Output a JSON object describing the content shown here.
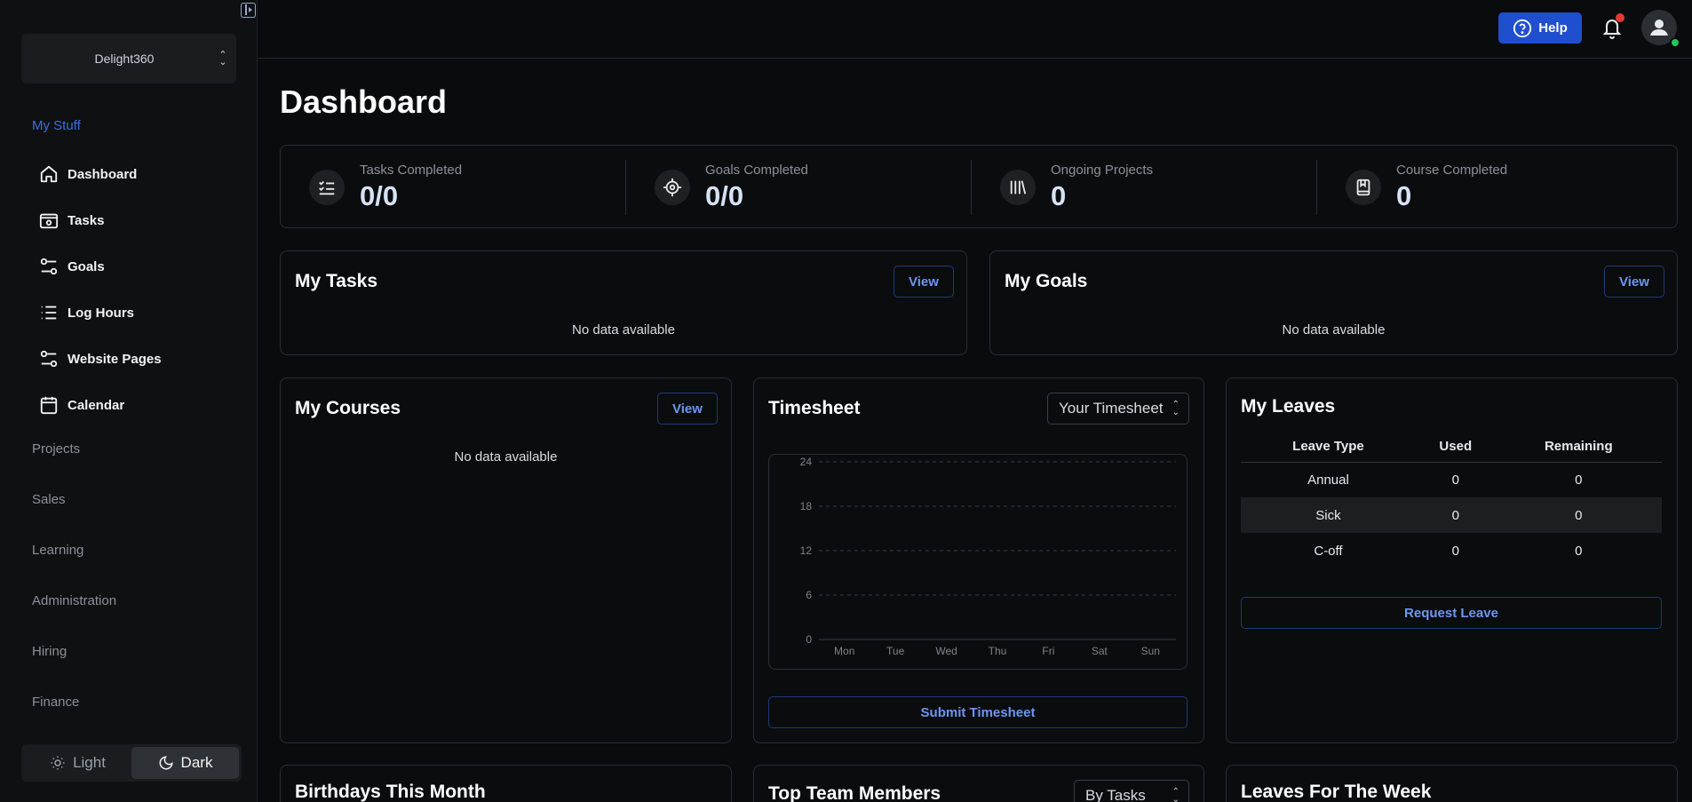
{
  "sidebar": {
    "org": "Delight360",
    "section_active": "My Stuff",
    "items": [
      {
        "label": "Dashboard",
        "icon": "home-icon"
      },
      {
        "label": "Tasks",
        "icon": "task-settings-icon"
      },
      {
        "label": "Goals",
        "icon": "sliders-icon"
      },
      {
        "label": "Log Hours",
        "icon": "list-icon"
      },
      {
        "label": "Website Pages",
        "icon": "sliders-icon"
      },
      {
        "label": "Calendar",
        "icon": "calendar-icon"
      }
    ],
    "sections": [
      "Projects",
      "Sales",
      "Learning",
      "Administration",
      "Hiring",
      "Finance"
    ],
    "theme": {
      "light": "Light",
      "dark": "Dark",
      "selected": "Dark"
    }
  },
  "header": {
    "help": "Help",
    "accent": "#1f4fcf"
  },
  "page": {
    "title": "Dashboard"
  },
  "stats": [
    {
      "label": "Tasks Completed",
      "value": "0/0",
      "icon": "checklist-icon"
    },
    {
      "label": "Goals Completed",
      "value": "0/0",
      "icon": "target-icon"
    },
    {
      "label": "Ongoing Projects",
      "value": "0",
      "icon": "library-icon"
    },
    {
      "label": "Course Completed",
      "value": "0",
      "icon": "book-bookmark-icon"
    }
  ],
  "my_tasks": {
    "title": "My Tasks",
    "view": "View",
    "empty": "No data available"
  },
  "my_goals": {
    "title": "My Goals",
    "view": "View",
    "empty": "No data available"
  },
  "my_courses": {
    "title": "My Courses",
    "view": "View",
    "empty": "No data available"
  },
  "timesheet": {
    "title": "Timesheet",
    "select": "Your Timesheet",
    "submit": "Submit Timesheet",
    "chart_data": {
      "type": "bar",
      "categories": [
        "Mon",
        "Tue",
        "Wed",
        "Thu",
        "Fri",
        "Sat",
        "Sun"
      ],
      "values": [
        0,
        0,
        0,
        0,
        0,
        0,
        0
      ],
      "yticks": [
        0,
        6,
        12,
        18,
        24
      ],
      "ylim": [
        0,
        24
      ],
      "grid": true
    }
  },
  "my_leaves": {
    "title": "My Leaves",
    "headers": [
      "Leave Type",
      "Used",
      "Remaining"
    ],
    "rows": [
      [
        "Annual",
        "0",
        "0"
      ],
      [
        "Sick",
        "0",
        "0"
      ],
      [
        "C-off",
        "0",
        "0"
      ]
    ],
    "request": "Request Leave"
  },
  "bottom": {
    "birthdays": "Birthdays This Month",
    "top_team": "Top Team Members",
    "top_team_select": "By Tasks",
    "leaves_week": "Leaves For The Week"
  }
}
